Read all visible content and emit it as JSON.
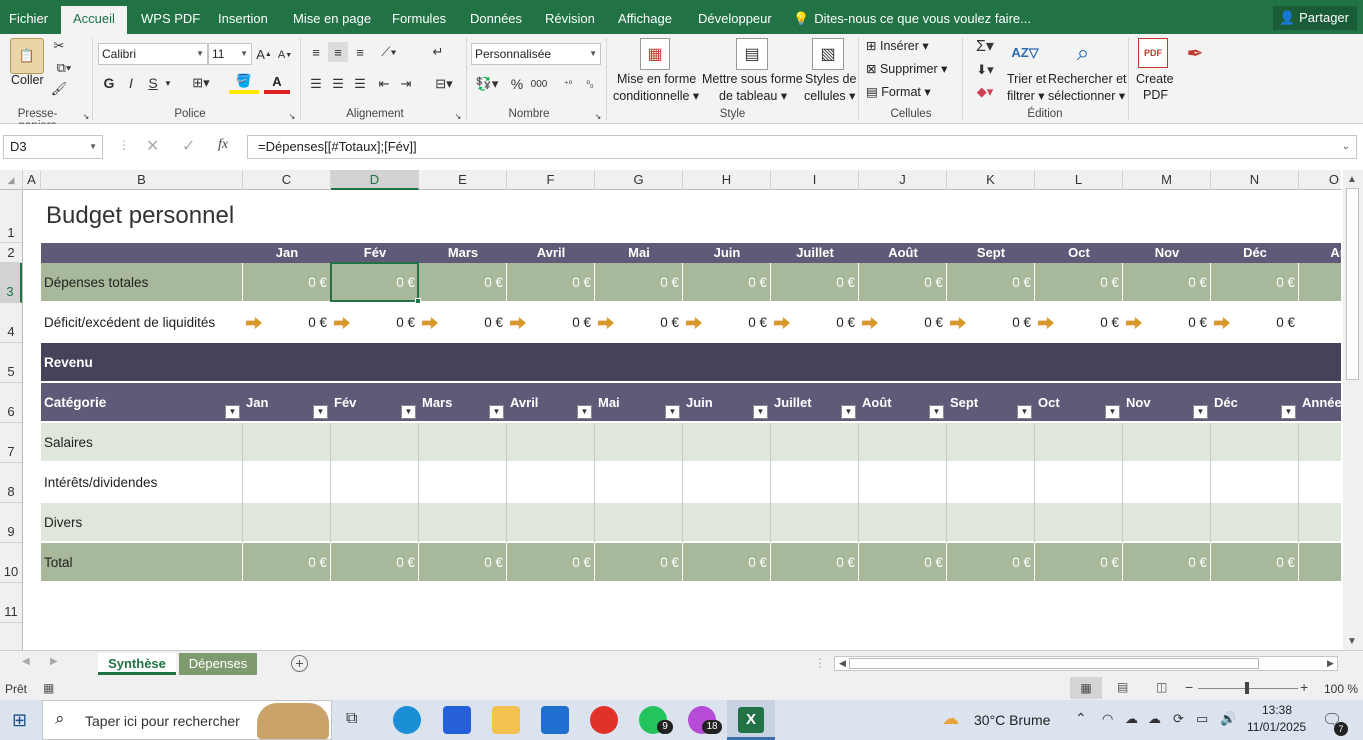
{
  "ribbon_tabs": [
    "Fichier",
    "Accueil",
    "WPS PDF",
    "Insertion",
    "Mise en page",
    "Formules",
    "Données",
    "Révision",
    "Affichage",
    "Développeur"
  ],
  "tell_me": "Dites-nous ce que vous voulez faire...",
  "share": "Partager",
  "ribbon": {
    "paste": "Coller",
    "clipboard_group": "Presse-papiers",
    "font_name": "Calibri",
    "font_size": "11",
    "font_group": "Police",
    "bold": "G",
    "italic": "I",
    "underline": "S",
    "alignment_group": "Alignement",
    "number_format": "Personnalisée",
    "percent": "%",
    "thousands": "000",
    "number_group": "Nombre",
    "cond_format_1": "Mise en forme",
    "cond_format_2": "conditionnelle",
    "table_format_1": "Mettre sous forme",
    "table_format_2": "de tableau",
    "cell_styles_1": "Styles de",
    "cell_styles_2": "cellules",
    "style_group": "Style",
    "insert": "Insérer",
    "delete": "Supprimer",
    "format": "Format",
    "cells_group": "Cellules",
    "sort_1": "Trier et",
    "sort_2": "filtrer",
    "find_1": "Rechercher et",
    "find_2": "sélectionner",
    "editing_group": "Édition",
    "create_pdf_1": "Create",
    "create_pdf_2": "PDF"
  },
  "formula_bar": {
    "name_box": "D3",
    "fx": "fx",
    "formula": "=Dépenses[[#Totaux];[Fév]]"
  },
  "columns": [
    "A",
    "B",
    "C",
    "D",
    "E",
    "F",
    "G",
    "H",
    "I",
    "J",
    "K",
    "L",
    "M",
    "N",
    "O"
  ],
  "rows": [
    "1",
    "2",
    "3",
    "4",
    "5",
    "6",
    "7",
    "8",
    "9",
    "10",
    "11"
  ],
  "sheet": {
    "title": "Budget personnel",
    "months": [
      "Jan",
      "Fév",
      "Mars",
      "Avril",
      "Mai",
      "Juin",
      "Juillet",
      "Août",
      "Sept",
      "Oct",
      "Nov",
      "Déc",
      "Ann"
    ],
    "expenses_label": "Dépenses totales",
    "deficit_label": "Déficit/excédent de liquidités",
    "zero": "0 €",
    "revenue_header": "Revenu",
    "category_header": "Catégorie",
    "revenue_months": [
      "Jan",
      "Fév",
      "Mars",
      "Avril",
      "Mai",
      "Juin",
      "Juillet",
      "Août",
      "Sept",
      "Oct",
      "Nov",
      "Déc",
      "Année"
    ],
    "categories": [
      "Salaires",
      "Intérêts/dividendes",
      "Divers"
    ],
    "total_label": "Total"
  },
  "sheet_tabs": [
    "Synthèse",
    "Dépenses"
  ],
  "status": {
    "ready": "Prêt",
    "zoom": "100 %"
  },
  "taskbar": {
    "search": "Taper ici pour rechercher",
    "weather": "30°C  Brume",
    "time": "13:38",
    "date": "11/01/2025",
    "whatsapp_badge": "9",
    "messenger_badge": "18",
    "notif_badge": "7"
  },
  "colors": {
    "excel_green": "#217346",
    "header_dark": "#5f5a78",
    "revenue_dark": "#46425a",
    "sage": "#a8b89a",
    "light_sage": "#dfe6da",
    "arrow": "#d89a2a"
  }
}
